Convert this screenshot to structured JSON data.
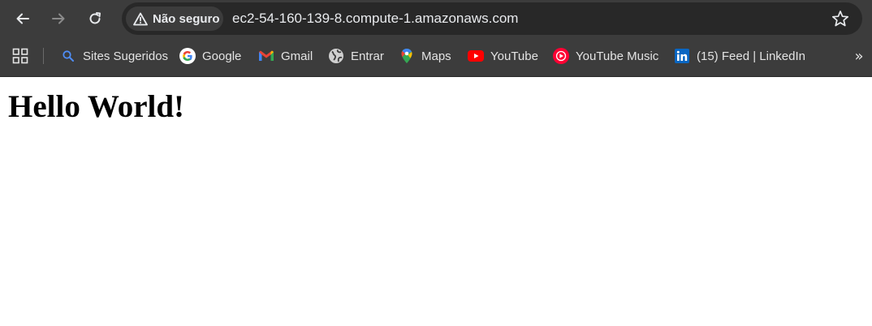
{
  "toolbar": {
    "security_label": "Não seguro",
    "url": "ec2-54-160-139-8.compute-1.amazonaws.com"
  },
  "bookmarks": [
    {
      "label": "Sites Sugeridos",
      "icon": "search-icon"
    },
    {
      "label": "Google",
      "icon": "google-icon"
    },
    {
      "label": "Gmail",
      "icon": "gmail-icon"
    },
    {
      "label": "Entrar",
      "icon": "globe-icon"
    },
    {
      "label": "Maps",
      "icon": "maps-pin-icon"
    },
    {
      "label": "YouTube",
      "icon": "youtube-icon"
    },
    {
      "label": "YouTube Music",
      "icon": "youtube-music-icon"
    },
    {
      "label": "(15) Feed | LinkedIn",
      "icon": "linkedin-icon"
    }
  ],
  "page": {
    "heading": "Hello World!"
  },
  "colors": {
    "chrome_bg": "#3c3c3c",
    "omnibox_bg": "#282828",
    "text_light": "#e8eaed",
    "page_bg": "#ffffff"
  }
}
